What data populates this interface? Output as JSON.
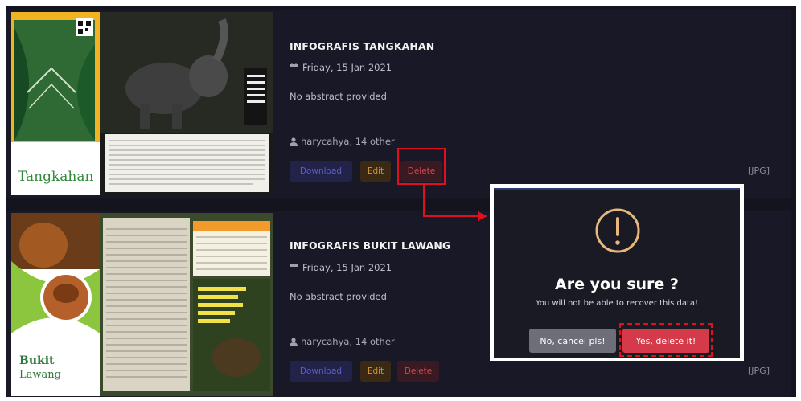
{
  "cards": [
    {
      "title": "INFOGRAFIS TANGKAHAN",
      "date": "Friday, 15 Jan 2021",
      "abstract": "No abstract provided",
      "author": "harycahya, 14 other",
      "type": "[JPG]",
      "thumb_text": "Tangkahan"
    },
    {
      "title": "INFOGRAFIS BUKIT LAWANG",
      "date": "Friday, 15 Jan 2021",
      "abstract": "No abstract provided",
      "author": "harycahya, 14 other",
      "type": "[JPG]",
      "thumb_text_1": "Bukit",
      "thumb_text_2": "Lawang"
    }
  ],
  "buttons": {
    "download": "Download",
    "edit": "Edit",
    "delete": "Delete"
  },
  "modal": {
    "title": "Are you sure ?",
    "message": "You will not be able to recover this data!",
    "cancel": "No, cancel pls!",
    "confirm": "Yes, delete it!"
  },
  "icons": {
    "date": "calendar-icon",
    "author": "user-icon",
    "modal": "exclamation-circle-icon"
  },
  "colors": {
    "background": "#14141f",
    "card": "#181826",
    "download": "#5a5fd0",
    "edit": "#d2943a",
    "delete": "#d8454f",
    "confirm": "#d53a4a",
    "cancel": "#6e6e78",
    "warning_ring": "#e8b77c",
    "annotation": "#e01020"
  }
}
